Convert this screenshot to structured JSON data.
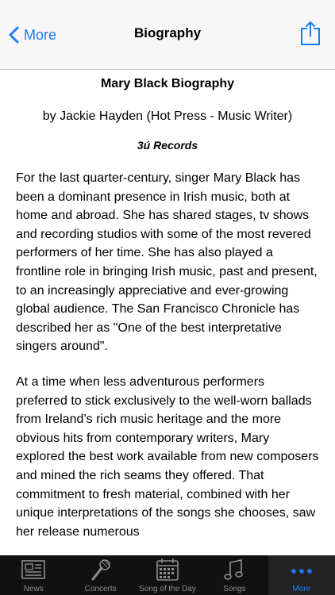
{
  "navbar": {
    "back_label": "More",
    "title": "Biography"
  },
  "bio": {
    "title": "Mary Black Biography",
    "author": "by Jackie Hayden (Hot Press - Music Writer)",
    "label": "3ú Records",
    "paragraphs": [
      "For the last quarter-century, singer Mary Black has been a dominant presence in Irish music, both at home and abroad. She has shared stages, tv shows and recording studios with some of the most revered performers of her time. She has also played a frontline role in bringing Irish music, past and present, to an increasingly appreciative and ever-growing global audience. The San Francisco Chronicle has described her as \"One of the best interpretative singers around\".",
      "At a time when less adventurous performers preferred to stick exclusively to the well-worn ballads from Ireland’s rich music heritage and the more obvious hits from contemporary writers, Mary explored the best work available from new composers and mined the rich seams they offered. That commitment to fresh material, combined with her unique interpretations of the songs she chooses, saw her release numerous"
    ]
  },
  "tabbar": {
    "tabs": [
      {
        "label": "News",
        "icon": "newspaper-icon"
      },
      {
        "label": "Concerts",
        "icon": "microphone-icon"
      },
      {
        "label": "Song of the Day",
        "icon": "calendar-icon"
      },
      {
        "label": "Songs",
        "icon": "music-note-icon"
      },
      {
        "label": "More",
        "icon": "more-dots-icon"
      }
    ],
    "active": "More"
  },
  "colors": {
    "accent": "#1a7cf5",
    "tabbar_bg": "#111111",
    "tab_inactive": "#8e8e93"
  }
}
